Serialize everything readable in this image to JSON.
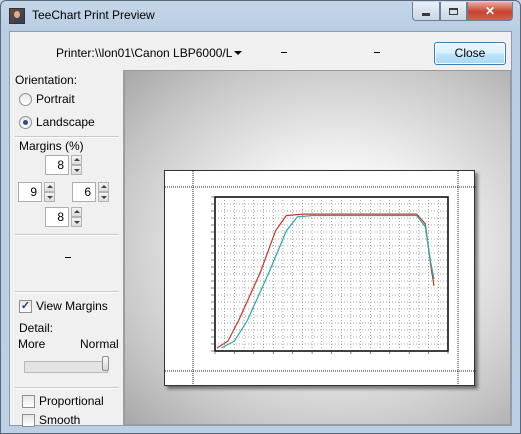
{
  "window": {
    "title": "TeeChart Print Preview",
    "controls": {
      "minimize_glyph": "",
      "maximize_glyph": "",
      "close_glyph": "✕"
    }
  },
  "toolbar": {
    "printer_label": "Printer:",
    "printer_value": "\\\\lon01\\Canon LBP6000/L",
    "close_label": "Close"
  },
  "left_panel": {
    "orientation": {
      "title": "Orientation:",
      "options": [
        {
          "label": "Portrait",
          "checked": false
        },
        {
          "label": "Landscape",
          "checked": true
        }
      ]
    },
    "margins": {
      "title": "Margins (%)",
      "top": "8",
      "left": "9",
      "right": "6",
      "bottom": "8"
    },
    "view_margins": {
      "label": "View Margins",
      "checked": true
    },
    "detail": {
      "title": "Detail:",
      "min_label": "More",
      "max_label": "Normal",
      "level": 1.0
    },
    "proportional": {
      "label": "Proportional",
      "checked": false
    },
    "smooth": {
      "label": "Smooth",
      "checked": false
    }
  },
  "colors": {
    "series_1": "#c0392b",
    "series_2": "#2aa7a0",
    "window_frame": "#bcd0e5",
    "close_button": "#c7432f"
  },
  "chart_data": {
    "type": "line",
    "title": "",
    "xlabel": "",
    "ylabel": "",
    "grid": true,
    "xlim": [
      0,
      1
    ],
    "ylim": [
      0,
      1
    ],
    "series": [
      {
        "x": [
          0.0,
          0.05,
          0.1,
          0.2,
          0.27,
          0.32,
          0.4,
          0.6,
          0.8,
          0.92,
          0.96,
          0.985,
          1.0
        ],
        "y": [
          0.0,
          0.05,
          0.2,
          0.55,
          0.85,
          0.96,
          0.97,
          0.97,
          0.97,
          0.97,
          0.9,
          0.6,
          0.45
        ]
      },
      {
        "x": [
          0.02,
          0.08,
          0.14,
          0.24,
          0.32,
          0.37,
          0.44,
          0.62,
          0.8,
          0.92,
          0.96,
          0.985,
          1.0
        ],
        "y": [
          0.0,
          0.05,
          0.2,
          0.55,
          0.85,
          0.95,
          0.96,
          0.96,
          0.96,
          0.96,
          0.88,
          0.62,
          0.5
        ]
      }
    ]
  }
}
